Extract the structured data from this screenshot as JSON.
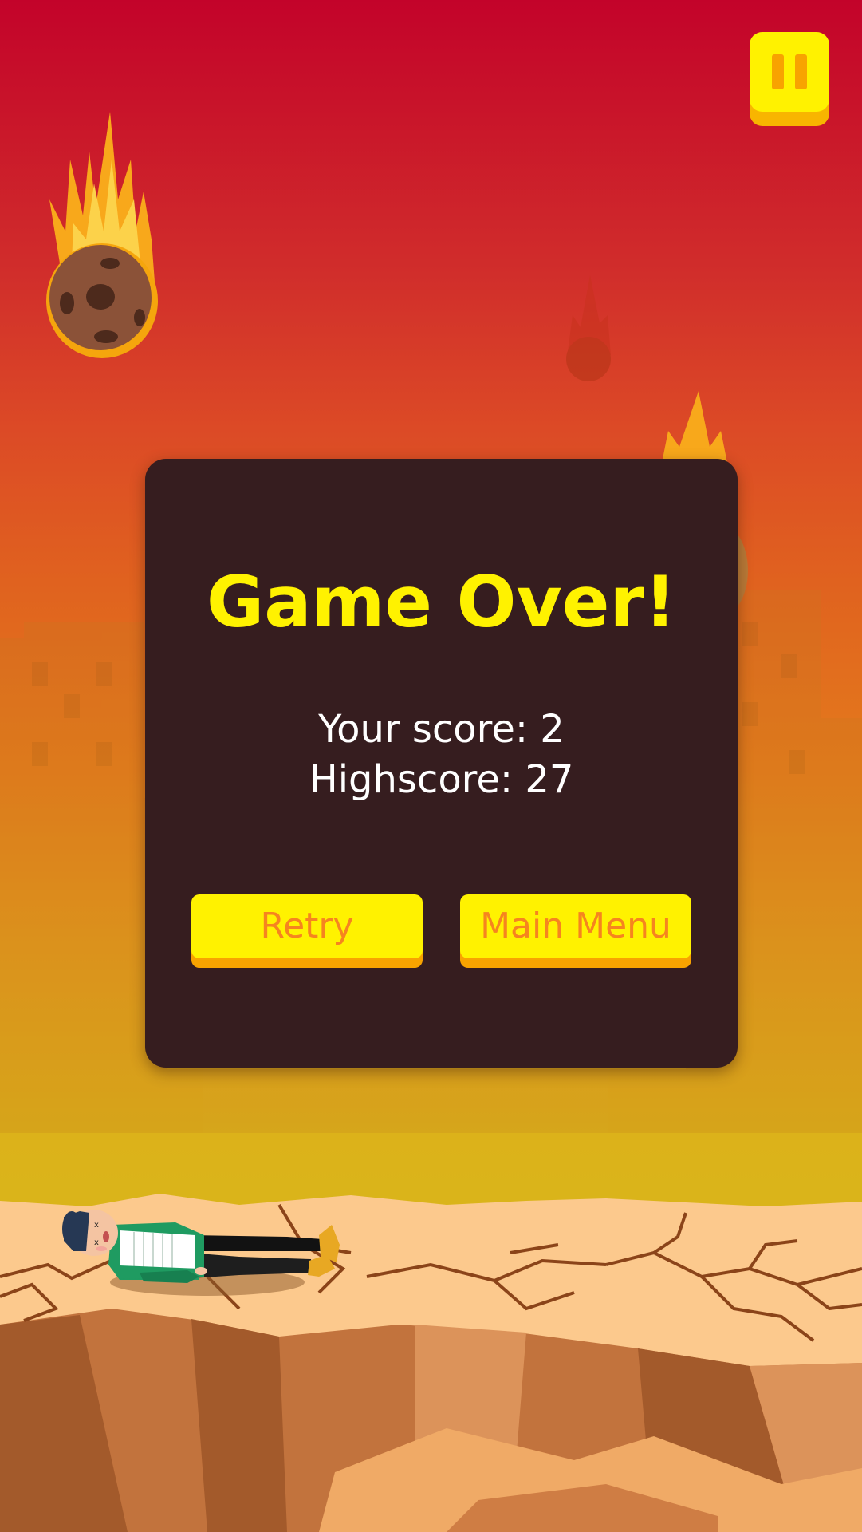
{
  "game_over": {
    "title": "Game Over!",
    "score_text": "Your score: 2",
    "highscore_text": "Highscore: 27",
    "retry_label": "Retry",
    "main_menu_label": "Main Menu"
  },
  "hud": {
    "pause_icon": "pause-icon"
  },
  "colors": {
    "panel": "#361d1f",
    "title": "#fff200",
    "button_face": "#fff200",
    "button_shadow": "#f8a300",
    "button_text": "#f6841f",
    "score_text": "#ffffff"
  }
}
